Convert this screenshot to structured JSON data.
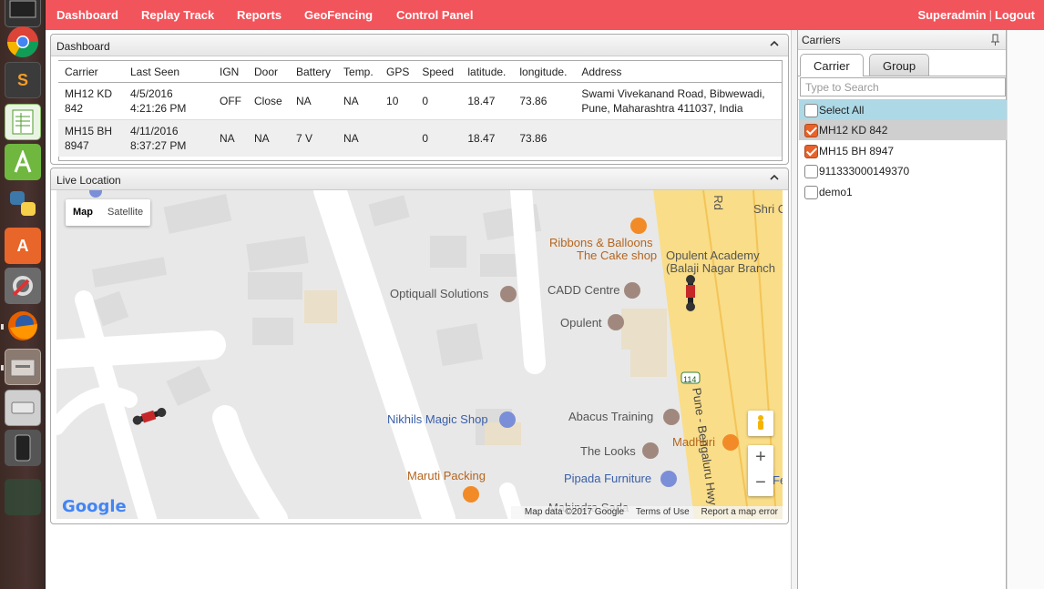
{
  "nav": {
    "items": [
      "Dashboard",
      "Replay Track",
      "Reports",
      "GeoFencing",
      "Control Panel"
    ],
    "user": "Superadmin",
    "separator": "|",
    "logout": "Logout"
  },
  "dashboard": {
    "title": "Dashboard",
    "columns": [
      "Carrier",
      "Last Seen",
      "IGN",
      "Door",
      "Battery",
      "Temp.",
      "GPS",
      "Speed",
      "latitude.",
      "longitude.",
      "Address"
    ],
    "rows": [
      [
        "MH12 KD 842",
        "4/5/2016 4:21:26 PM",
        "OFF",
        "Close",
        "NA",
        "NA",
        "10",
        "0",
        "18.47",
        "73.86",
        "Swami Vivekanand Road, Bibwewadi, Pune, Maharashtra 411037, India"
      ],
      [
        "MH15 BH 8947",
        "4/11/2016 8:37:27 PM",
        "NA",
        "NA",
        "7 V",
        "NA",
        "",
        "0",
        "18.47",
        "73.86",
        ""
      ]
    ]
  },
  "live_location": {
    "title": "Live Location",
    "map_types": [
      "Map",
      "Satellite"
    ],
    "active_map_type": "Map",
    "pois": {
      "ribbons": "Ribbons & Balloons",
      "cake": "The Cake shop",
      "opulent_academy": "Opulent Academy",
      "balaji": "(Balaji Nagar Branch",
      "optiquall": "Optiquall Solutions",
      "cadd": "CADD Centre",
      "opulent": "Opulent",
      "nikhils": "Nikhils Magic Shop",
      "abacus": "Abacus Training",
      "madhuri": "Madhuri",
      "looks": "The Looks",
      "pipada": "Pipada Furniture",
      "maruti": "Maruti Packing",
      "mahindra": "Mahindra Sada",
      "road_rd": "Rd",
      "road_shri": "Shri C",
      "highway": "Pune - Bengaluru Hwy",
      "highway_num": "114",
      "fe": "Fe"
    },
    "zoom_in": "+",
    "zoom_out": "−",
    "google_logo": "Google",
    "footer": {
      "map_data": "Map data ©2017 Google",
      "terms": "Terms of Use",
      "report": "Report a map error"
    }
  },
  "carriers": {
    "title": "Carriers",
    "tabs": [
      "Carrier",
      "Group"
    ],
    "active_tab": "Carrier",
    "search_placeholder": "Type to Search",
    "items": [
      {
        "label": "Select All",
        "checked": false
      },
      {
        "label": "MH12 KD 842",
        "checked": true
      },
      {
        "label": "MH15 BH 8947",
        "checked": true
      },
      {
        "label": "911333000149370",
        "checked": false
      },
      {
        "label": "demo1",
        "checked": false
      }
    ]
  },
  "colors": {
    "nav_bg": "#f2545b",
    "checkbox_checked": "#e8622b",
    "select_all_bg": "#add8e6",
    "highway_yellow": "#f9dd88"
  }
}
